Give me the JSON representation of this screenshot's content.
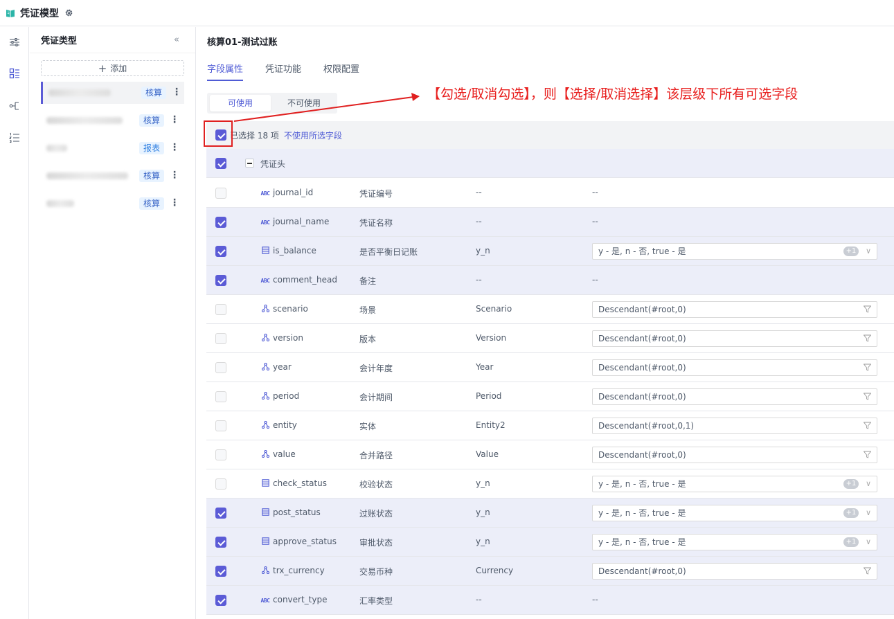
{
  "header": {
    "title": "凭证模型"
  },
  "sidebar": {
    "title": "凭证类型",
    "add_label": "添加",
    "items": [
      {
        "tag": "核算"
      },
      {
        "tag": "核算"
      },
      {
        "tag": "报表"
      },
      {
        "tag": "核算"
      },
      {
        "tag": "核算"
      }
    ]
  },
  "main": {
    "title": "核算01-测试过账",
    "tabs": [
      {
        "label": "字段属性"
      },
      {
        "label": "凭证功能"
      },
      {
        "label": "权限配置"
      }
    ],
    "segment": {
      "on": "可使用",
      "off": "不可使用"
    },
    "selection": {
      "text": "已选择 18 项",
      "link": "不使用所选字段"
    },
    "group": {
      "label": "凭证头"
    },
    "rows": [
      {
        "field": "journal_id",
        "desc": "凭证编号",
        "dim": "--",
        "value": "--"
      },
      {
        "field": "journal_name",
        "desc": "凭证名称",
        "dim": "--",
        "value": "--"
      },
      {
        "field": "is_balance",
        "desc": "是否平衡日记账",
        "dim": "y_n",
        "value": "y - 是, n - 否, true - 是",
        "badge": "+1"
      },
      {
        "field": "comment_head",
        "desc": "备注",
        "dim": "--",
        "value": "--"
      },
      {
        "field": "scenario",
        "desc": "场景",
        "dim": "Scenario",
        "value": "Descendant(#root,0)"
      },
      {
        "field": "version",
        "desc": "版本",
        "dim": "Version",
        "value": "Descendant(#root,0)"
      },
      {
        "field": "year",
        "desc": "会计年度",
        "dim": "Year",
        "value": "Descendant(#root,0)"
      },
      {
        "field": "period",
        "desc": "会计期间",
        "dim": "Period",
        "value": "Descendant(#root,0)"
      },
      {
        "field": "entity",
        "desc": "实体",
        "dim": "Entity2",
        "value": "Descendant(#root,0,1)"
      },
      {
        "field": "value",
        "desc": "合并路径",
        "dim": "Value",
        "value": "Descendant(#root,0)"
      },
      {
        "field": "check_status",
        "desc": "校验状态",
        "dim": "y_n",
        "value": "y - 是, n - 否, true - 是",
        "badge": "+1"
      },
      {
        "field": "post_status",
        "desc": "过账状态",
        "dim": "y_n",
        "value": "y - 是, n - 否, true - 是",
        "badge": "+1"
      },
      {
        "field": "approve_status",
        "desc": "审批状态",
        "dim": "y_n",
        "value": "y - 是, n - 否, true - 是",
        "badge": "+1"
      },
      {
        "field": "trx_currency",
        "desc": "交易币种",
        "dim": "Currency",
        "value": "Descendant(#root,0)"
      },
      {
        "field": "convert_type",
        "desc": "汇率类型",
        "dim": "--",
        "value": "--"
      }
    ]
  },
  "annotation": {
    "text": "【勾选/取消勾选】，则【选择/取消选择】该层级下所有可选字段"
  },
  "colors": {
    "accent": "#4f5bd5",
    "checkbox": "#5b5bd6",
    "selected_row": "#eceef9",
    "annotation": "#e8201f"
  }
}
